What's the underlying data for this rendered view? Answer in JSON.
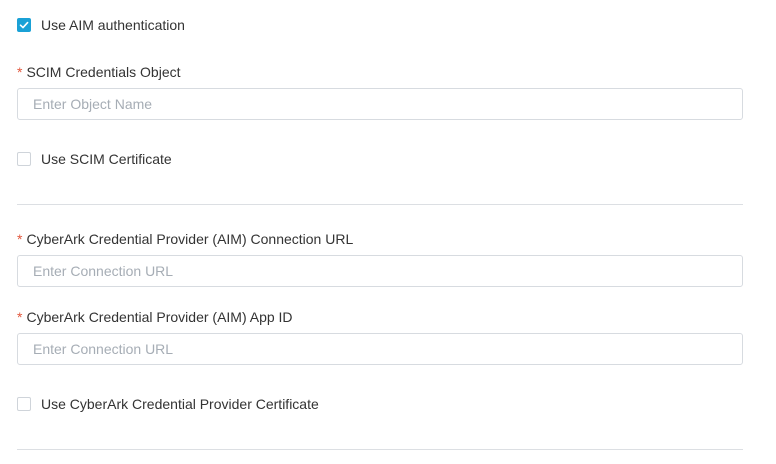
{
  "aim_auth": {
    "label": "Use AIM authentication",
    "checked": true
  },
  "scim_credentials": {
    "required_mark": "*",
    "label": "SCIM Credentials Object",
    "placeholder": "Enter Object Name",
    "value": ""
  },
  "scim_certificate": {
    "label": "Use SCIM Certificate",
    "checked": false
  },
  "aim_connection_url": {
    "required_mark": "*",
    "label": "CyberArk Credential Provider (AIM) Connection URL",
    "placeholder": "Enter Connection URL",
    "value": ""
  },
  "aim_app_id": {
    "required_mark": "*",
    "label": "CyberArk Credential Provider (AIM) App ID",
    "placeholder": "Enter Connection URL",
    "value": ""
  },
  "cyberark_certificate": {
    "label": "Use CyberArk Credential Provider Certificate",
    "checked": false
  },
  "colors": {
    "accent": "#1aa1d6",
    "required": "#e2563b",
    "border": "#d7dbe0",
    "placeholder": "#a6adb5"
  }
}
